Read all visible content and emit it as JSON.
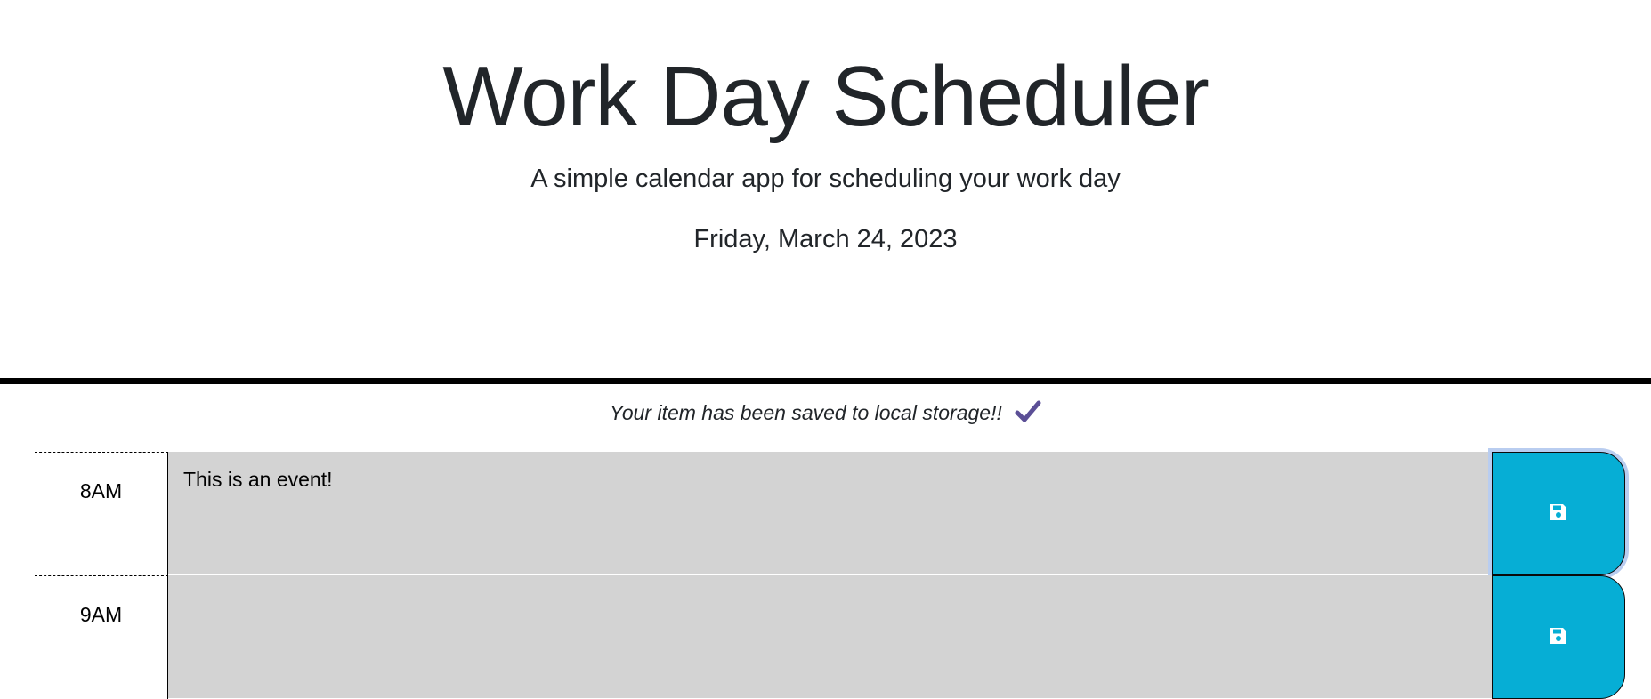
{
  "header": {
    "title": "Work Day Scheduler",
    "subtitle": "A simple calendar app for scheduling your work day",
    "current_day": "Friday, March 24, 2023"
  },
  "notification": {
    "text": "Your item has been saved to local storage!!",
    "icon": "checkmark-icon",
    "icon_color": "#5b4f96"
  },
  "colors": {
    "past_block": "#d3d3d3",
    "save_button": "#06aed5",
    "header_border": "#000000"
  },
  "schedule": {
    "rows": [
      {
        "hour": "8AM",
        "description": "This is an event!",
        "save_icon": "floppy-disk-icon"
      },
      {
        "hour": "9AM",
        "description": "",
        "save_icon": "floppy-disk-icon"
      }
    ]
  }
}
